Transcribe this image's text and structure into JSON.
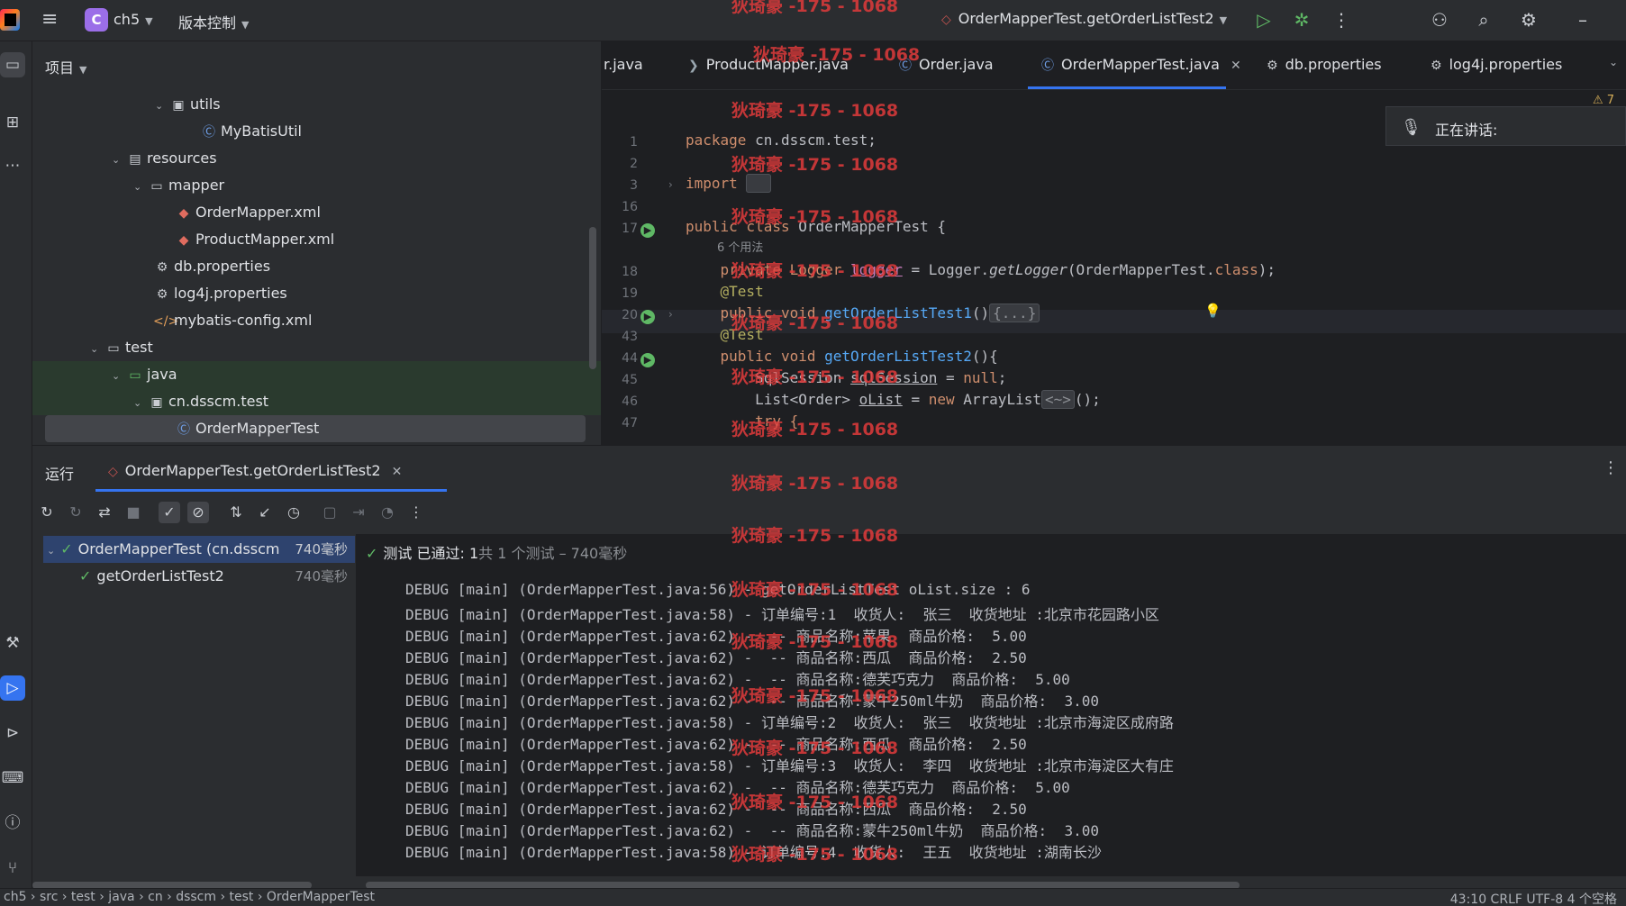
{
  "titlebar": {
    "project_badge": "C",
    "project_name": "ch5",
    "vcs_label": "版本控制",
    "run_config": "OrderMapperTest.getOrderListTest2",
    "icons": [
      "hamburger-icon",
      "run-icon",
      "debug-icon",
      "more-icon",
      "add-user-icon",
      "search-icon",
      "settings-icon",
      "minimize-icon"
    ]
  },
  "project_panel": {
    "header": "项目",
    "tree": [
      {
        "label": "utils",
        "icon": "folder-icon",
        "expanded": true
      },
      {
        "label": "MyBatisUtil",
        "icon": "class-icon"
      },
      {
        "label": "resources",
        "icon": "resources-folder-icon",
        "expanded": true
      },
      {
        "label": "mapper",
        "icon": "folder-icon",
        "expanded": true
      },
      {
        "label": "OrderMapper.xml",
        "icon": "xml-icon"
      },
      {
        "label": "ProductMapper.xml",
        "icon": "xml-icon"
      },
      {
        "label": "db.properties",
        "icon": "properties-icon"
      },
      {
        "label": "log4j.properties",
        "icon": "properties-icon"
      },
      {
        "label": "mybatis-config.xml",
        "icon": "xml-config-icon"
      },
      {
        "label": "test",
        "icon": "folder-icon",
        "expanded": true
      },
      {
        "label": "java",
        "icon": "folder-icon",
        "expanded": true
      },
      {
        "label": "cn.dsscm.test",
        "icon": "package-icon",
        "expanded": true
      },
      {
        "label": "OrderMapperTest",
        "icon": "class-icon",
        "selected": true
      }
    ]
  },
  "editor": {
    "tabs": [
      {
        "label": "r.java"
      },
      {
        "label": "ProductMapper.java"
      },
      {
        "label": "Order.java"
      },
      {
        "label": "OrderMapperTest.java",
        "active": true
      },
      {
        "label": "db.properties"
      },
      {
        "label": "log4j.properties"
      }
    ],
    "warning_count": "⚠ 7",
    "talk_popup": "正在讲话:",
    "usage_hint": "6 个用法",
    "line_numbers": [
      "1",
      "2",
      "3",
      "16",
      "17",
      "18",
      "19",
      "20",
      "43",
      "44",
      "45",
      "46",
      "47"
    ],
    "lines": {
      "l1": "package cn.dsscm.test;",
      "l3": "import",
      "l17": "public class OrderMapperTest {",
      "l18a": "    private Logger ",
      "l18b": "logger",
      "l18c": " = Logger.",
      "l18d": "getLogger",
      "l18e": "(OrderMapperTest.",
      "l18f": "class",
      "l18g": ");",
      "l19": "    @Test",
      "l20a": "    public void ",
      "l20b": "getOrderListTest1",
      "l20c": "()",
      "l20d": "{...}",
      "l43": "    @Test",
      "l44a": "    public void ",
      "l44b": "getOrderListTest2",
      "l44c": "(){",
      "l45a": "        SqlSession ",
      "l45b": "sqlSession",
      "l45c": " = ",
      "l45d": "null",
      "l45e": ";",
      "l46a": "        List<Order> ",
      "l46b": "oList",
      "l46c": " = ",
      "l46d": "new",
      "l46e": " ArrayList",
      "l46f": "<~>",
      "l46g": "();",
      "l47": "        try {"
    }
  },
  "run_panel": {
    "title": "运行",
    "tab_label": "OrderMapperTest.getOrderListTest2",
    "tests": [
      {
        "label": "OrderMapperTest (cn.dsscm",
        "time": "740毫秒"
      },
      {
        "label": "getOrderListTest2",
        "time": "740毫秒"
      }
    ],
    "status_main": "测试 已通过: 1",
    "status_sub": "共 1 个测试 – 740毫秒",
    "log_lines": [
      "DEBUG [main] (OrderMapperTest.java:56) - getOrderListTest oList.size : 6",
      "DEBUG [main] (OrderMapperTest.java:58) - 订单编号:1  收货人:  张三  收货地址 :北京市花园路小区",
      "DEBUG [main] (OrderMapperTest.java:62) -  -- 商品名称:苹果  商品价格:  5.00",
      "DEBUG [main] (OrderMapperTest.java:62) -  -- 商品名称:西瓜  商品价格:  2.50",
      "DEBUG [main] (OrderMapperTest.java:62) -  -- 商品名称:德芙巧克力  商品价格:  5.00",
      "DEBUG [main] (OrderMapperTest.java:62) -  -- 商品名称:蒙牛250ml牛奶  商品价格:  3.00",
      "DEBUG [main] (OrderMapperTest.java:58) - 订单编号:2  收货人:  张三  收货地址 :北京市海淀区成府路",
      "DEBUG [main] (OrderMapperTest.java:62) -  -- 商品名称:西瓜  商品价格:  2.50",
      "DEBUG [main] (OrderMapperTest.java:58) - 订单编号:3  收货人:  李四  收货地址 :北京市海淀区大有庄",
      "DEBUG [main] (OrderMapperTest.java:62) -  -- 商品名称:德芙巧克力  商品价格:  5.00",
      "DEBUG [main] (OrderMapperTest.java:62) -  -- 商品名称:西瓜  商品价格:  2.50",
      "DEBUG [main] (OrderMapperTest.java:62) -  -- 商品名称:蒙牛250ml牛奶  商品价格:  3.00",
      "DEBUG [main] (OrderMapperTest.java:58) - 订单编号:4  收货人:  王五  收货地址 :湖南长沙"
    ]
  },
  "statusbar": {
    "breadcrumb": "ch5 › src › test › java › cn › dsscm › test › OrderMapperTest",
    "right": "43:10   CRLF   UTF-8   4 个空格"
  },
  "watermark": "狄琦豪 -175 - 1068",
  "colors": {
    "accent": "#3574f0",
    "pass": "#5fb865",
    "watermark": "#e03b3b",
    "keyword": "#cf8e6d",
    "function": "#56a8f5"
  }
}
